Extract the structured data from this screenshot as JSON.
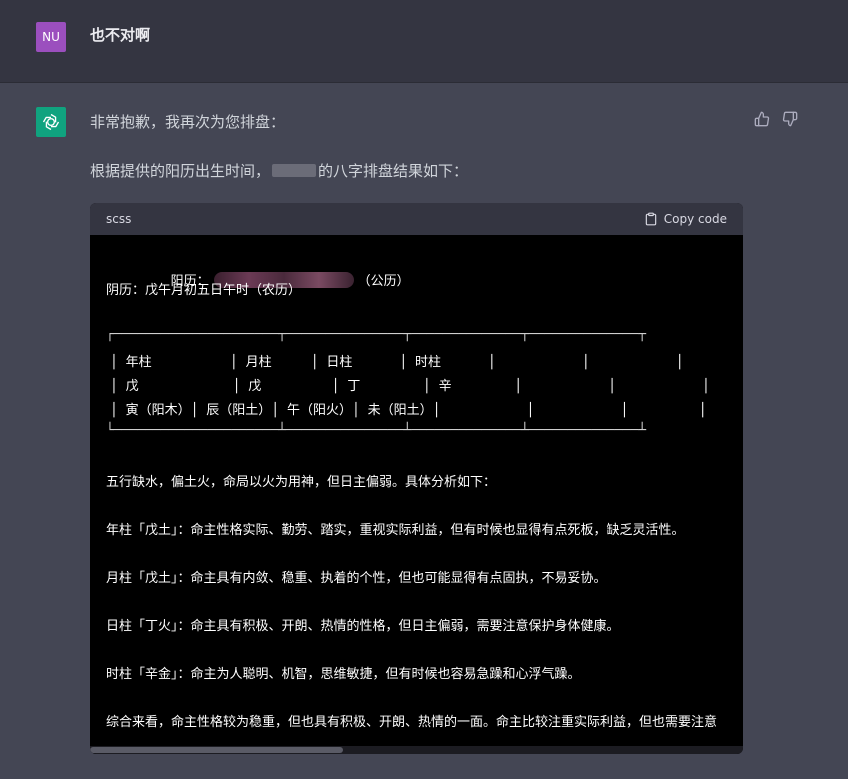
{
  "user": {
    "avatar_text": "NU",
    "message": "也不对啊"
  },
  "assistant": {
    "paragraph1": "非常抱歉，我再次为您排盘：",
    "paragraph2_prefix": "根据提供的阳历出生时间，",
    "paragraph2_suffix": "的八字排盘结果如下：",
    "feedback": {
      "thumbs_up_icon": "thumbs-up-icon",
      "thumbs_down_icon": "thumbs-down-icon"
    }
  },
  "code_block": {
    "language": "scss",
    "copy_label": "Copy code",
    "lines": {
      "yangli_prefix": "阳历：",
      "yangli_suffix": "（公历）",
      "yinli": "阴历：戊午月初五日午时（农历）",
      "table_top": "┌─────────────────────┬───────────────┬──────────────┬──────────────┬",
      "table_row1": "│ 年柱          │ 月柱     │ 日柱      │ 时柱      │           │           │         │",
      "table_row2": "│ 戊            │ 戊         │ 丁        │ 辛        │           │           │         │",
      "table_row3": "│ 寅（阳木）│ 辰（阳土）│ 午（阳火）│ 未（阳土）│           │           │         │",
      "table_bottom": "└─────────────────────┴───────────────┴──────────────┴──────────────┴",
      "summary": "五行缺水，偏土火，命局以火为用神，但日主偏弱。具体分析如下：",
      "year": "年柱「戊土」：命主性格实际、勤劳、踏实，重视实际利益，但有时候也显得有点死板，缺乏灵活性。",
      "month": "月柱「戊土」：命主具有内敛、稳重、执着的个性，但也可能显得有点固执，不易妥协。",
      "day": "日柱「丁火」：命主具有积极、开朗、热情的性格，但日主偏弱，需要注意保护身体健康。",
      "hour": "时柱「辛金」：命主为人聪明、机智，思维敏捷，但有时候也容易急躁和心浮气躁。",
      "conclusion": "综合来看，命主性格较为稳重，但也具有积极、开朗、热情的一面。命主比较注重实际利益，但也需要注意"
    }
  }
}
